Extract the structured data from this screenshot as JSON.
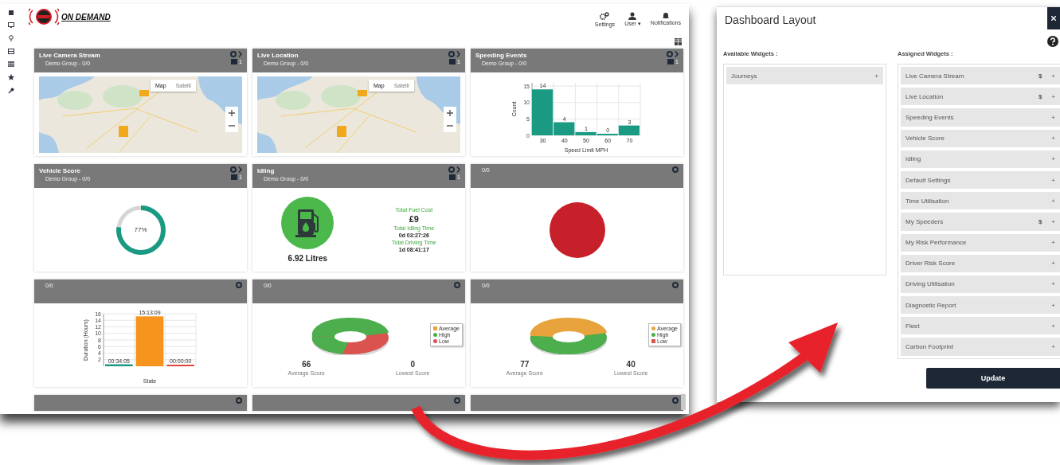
{
  "dashboard": {
    "logo_text": "ON DEMAND",
    "header_actions": [
      {
        "kind": "settings",
        "label": "Settings"
      },
      {
        "kind": "user",
        "label": "User ▾"
      },
      {
        "kind": "bell",
        "label": "Notifications"
      }
    ],
    "widgets": [
      {
        "kind": "map",
        "title": "Live Camera Stream",
        "subtitle": "Demo Group - 0/0",
        "count": "1",
        "map_types": [
          "Map",
          "Satelli"
        ]
      },
      {
        "kind": "map",
        "title": "Live Location",
        "subtitle": "Demo Group - 0/0",
        "count": "1",
        "map_types": [
          "Map",
          "Satelli"
        ]
      },
      {
        "kind": "bar",
        "title": "Speeding Events",
        "subtitle": "Demo Group - 0/0",
        "count": "1",
        "chart_data": {
          "type": "bar",
          "xlabel": "Speed Limit MPH",
          "ylabel": "Count",
          "categories": [
            "30",
            "40",
            "50",
            "60",
            "70"
          ],
          "values": [
            14,
            4,
            1,
            0,
            3
          ],
          "yticks": [
            0,
            5,
            10,
            15
          ],
          "ylim": [
            0,
            16
          ],
          "grid": true,
          "data_labels": true
        }
      },
      {
        "kind": "gauge",
        "title": "Vehicle Score",
        "subtitle": "Demo Group - 0/0",
        "count": "1",
        "level": 0.77,
        "reading": "77%"
      },
      {
        "kind": "idling",
        "title": "Idling",
        "subtitle": "Demo Group - 0/0",
        "count": "1",
        "volume": "6.92 Litres",
        "stats": [
          {
            "label": "Total Fuel Cost",
            "value": "£9",
            "big": true
          },
          {
            "label": "Total Idling Time",
            "value": "0d 03:27:26",
            "big": false
          },
          {
            "label": "Total Driving Time",
            "value": "1d 08:41:17",
            "big": false
          }
        ]
      },
      {
        "kind": "dot",
        "subtitle": "0/0"
      },
      {
        "kind": "timebar",
        "subtitle": "0/0",
        "chart_data": {
          "type": "bar",
          "xlabel": "State",
          "ylabel": "Duration (Hours)",
          "categories": [
            "00:34:05",
            "15:13:09",
            "00:00:00"
          ],
          "values": [
            0.6,
            15.2,
            0
          ],
          "yticks": [
            2,
            4,
            6,
            8,
            10,
            12,
            14,
            16
          ],
          "ylim": [
            0,
            16
          ],
          "grid": true
        }
      },
      {
        "kind": "donut",
        "subtitle": "0/0",
        "legend": [
          {
            "label": "Average",
            "color": "#e8a33c",
            "in_chart": false
          },
          {
            "label": "High",
            "color": "#4cae4c",
            "in_chart": true
          },
          {
            "label": "Low",
            "color": "#d9534f",
            "in_chart": true
          }
        ],
        "scores": [
          {
            "value": "66",
            "label": "Average Score"
          },
          {
            "value": "0",
            "label": "Lowest Score"
          }
        ]
      },
      {
        "kind": "donut",
        "subtitle": "0/0",
        "legend": [
          {
            "label": "Average",
            "color": "#e8a33c",
            "in_chart": true
          },
          {
            "label": "High",
            "color": "#4cae4c",
            "in_chart": true
          },
          {
            "label": "Low",
            "color": "#d9534f",
            "in_chart": false
          }
        ],
        "scores": [
          {
            "value": "77",
            "label": "Average Score"
          },
          {
            "value": "40",
            "label": "Lowest Score"
          }
        ]
      },
      {
        "kind": "cut"
      },
      {
        "kind": "cut"
      },
      {
        "kind": "cut"
      }
    ]
  },
  "layout_panel": {
    "title": "Dashboard Layout",
    "available_label": "Available Widgets :",
    "assigned_label": "Assigned Widgets :",
    "available": [
      {
        "name": "Journeys",
        "sign": "+"
      }
    ],
    "assigned": [
      {
        "name": "Live Camera Stream",
        "badge": "$",
        "sign": "+"
      },
      {
        "name": "Live Location",
        "badge": "$",
        "sign": "+"
      },
      {
        "name": "Speeding Events",
        "sign": "+"
      },
      {
        "name": "Vehicle Score",
        "sign": "+"
      },
      {
        "name": "Idling",
        "sign": "+"
      },
      {
        "name": "Default Settings",
        "sign": "+"
      },
      {
        "name": "Time Utilisation",
        "sign": "+"
      },
      {
        "name": "My Speeders",
        "badge": "$",
        "sign": "+"
      },
      {
        "name": "My Risk Performance",
        "sign": "+"
      },
      {
        "name": "Driver Risk Score",
        "sign": "+"
      },
      {
        "name": "Driving Utilisation",
        "sign": "+"
      },
      {
        "name": "Diagnostic Report",
        "sign": "+"
      },
      {
        "name": "Fleet",
        "sign": "+"
      },
      {
        "name": "Carbon Footprint",
        "sign": "+"
      }
    ],
    "button": "Update"
  }
}
